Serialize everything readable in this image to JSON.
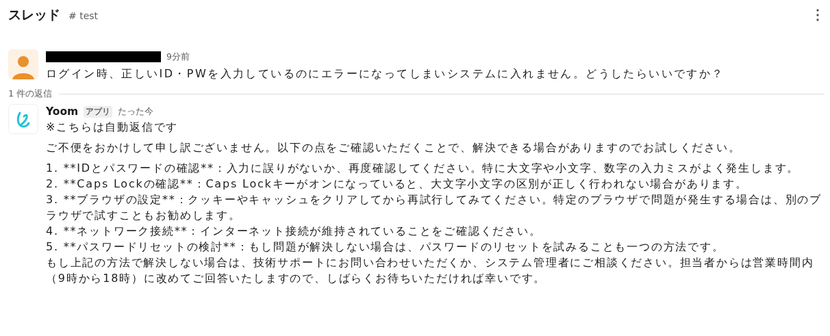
{
  "header": {
    "title": "スレッド",
    "channel": "# test"
  },
  "parent_message": {
    "time": "9分前",
    "text": "ログイン時、正しいID・PWを入力しているのにエラーになってしまいシステムに入れません。どうしたらいいですか？"
  },
  "reply_count": "1 件の返信",
  "reply": {
    "author": "Yoom",
    "badge": "アプリ",
    "time": "たった今",
    "blocks": [
      [
        "※こちらは自動返信です"
      ],
      [
        "ご不便をおかけして申し訳ございません。以下の点をご確認いただくことで、解決できる場合がありますのでお試しください。"
      ],
      [
        "1. **IDとパスワードの確認**：入力に誤りがないか、再度確認してください。特に大文字や小文字、数字の入力ミスがよく発生します。",
        "2. **Caps Lockの確認**：Caps Lockキーがオンになっていると、大文字小文字の区別が正しく行われない場合があります。",
        "3. **ブラウザの設定**：クッキーやキャッシュをクリアしてから再試行してみてください。特定のブラウザで問題が発生する場合は、別のブラウザで試すこともお勧めします。",
        "4. **ネットワーク接続**：インターネット接続が維持されていることをご確認ください。",
        "5. **パスワードリセットの検討**：もし問題が解決しない場合は、パスワードのリセットを試みることも一つの方法です。",
        "もし上記の方法で解決しない場合は、技術サポートにお問い合わせいただくか、システム管理者にご相談ください。担当者からは営業時間内（9時から18時）に改めてご回答いたしますので、しばらくお待ちいただければ幸いです。"
      ]
    ]
  }
}
